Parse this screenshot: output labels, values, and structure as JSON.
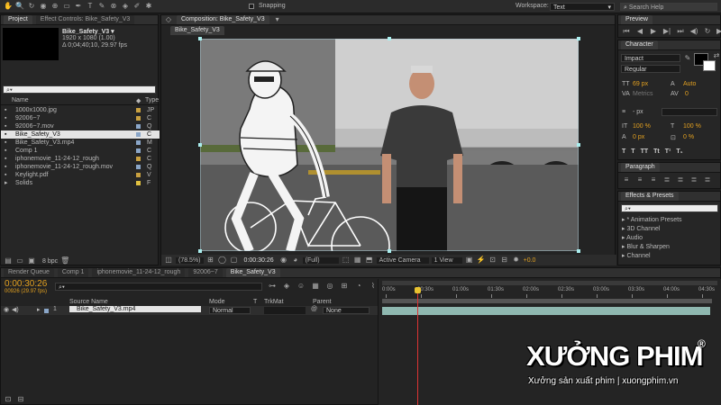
{
  "toolbar": {
    "snapping_label": "Snapping",
    "workspace_label": "Workspace:",
    "workspace_value": "Text",
    "search_placeholder": "Search Help",
    "tools": [
      "hand-tool",
      "zoom-tool",
      "rotate-tool",
      "camera-tool",
      "pan-tool",
      "rect-mask-tool",
      "pen-tool",
      "type-tool",
      "brush-tool",
      "clone-tool",
      "eraser-tool",
      "roto-tool",
      "puppet-tool"
    ]
  },
  "project": {
    "tab_project": "Project",
    "tab_effect_controls": "Effect Controls: Bike_Safety_V3",
    "comp_name": "Bike_Safety_V3 ▾",
    "comp_dims": "1920 x 1080 (1.00)",
    "comp_duration": "Δ 0;04;40;10, 29.97 fps",
    "col_name": "Name",
    "col_type": "Type",
    "bpc": "8 bpc",
    "items": [
      {
        "name": "1000x1000.jpg",
        "type": "JP",
        "color": "#c8a040",
        "selected": false
      },
      {
        "name": "92006~7",
        "type": "C",
        "color": "#c8a040",
        "selected": false
      },
      {
        "name": "92006~7.mov",
        "type": "Q",
        "color": "#8aa6c8",
        "selected": false
      },
      {
        "name": "Bike_Safety_V3",
        "type": "C",
        "color": "#8aa6c8",
        "selected": true
      },
      {
        "name": "Bike_Safety_V3.mp4",
        "type": "M",
        "color": "#8aa6c8",
        "selected": false
      },
      {
        "name": "Comp 1",
        "type": "C",
        "color": "#8aa6c8",
        "selected": false
      },
      {
        "name": "iphonemovie_11-24-12_rough",
        "type": "C",
        "color": "#c8a040",
        "selected": false
      },
      {
        "name": "iphonemovie_11-24-12_rough.mov",
        "type": "Q",
        "color": "#8aa6c8",
        "selected": false
      },
      {
        "name": "Keylight.pdf",
        "type": "V",
        "color": "#c8a040",
        "selected": false
      },
      {
        "name": "Solids",
        "type": "F",
        "color": "#e0c040",
        "selected": false
      }
    ]
  },
  "composition": {
    "tab": "Composition: Bike_Safety_V3",
    "sub_tab": "Bike_Safety_V3",
    "zoom": "(78.5%)",
    "timecode": "0:00:30:26",
    "resolution": "(Full)",
    "camera": "Active Camera",
    "view": "1 View",
    "exposure": "+0.0"
  },
  "preview": {
    "title": "Preview"
  },
  "character": {
    "title": "Character",
    "font": "Impact",
    "style": "Regular",
    "size": "69 px",
    "leading": "Auto",
    "kerning": "Metrics",
    "tracking": "0",
    "stroke_unit": "- px",
    "vscale": "100 %",
    "hscale": "100 %",
    "baseline": "0 px",
    "tsume": "0 %",
    "fill_color": "#000000",
    "stroke_color": "#ffffff"
  },
  "paragraph": {
    "title": "Paragraph"
  },
  "effects": {
    "title": "Effects & Presets",
    "items": [
      "* Animation Presets",
      "3D Channel",
      "Audio",
      "Blur & Sharpen",
      "Channel"
    ]
  },
  "timeline": {
    "tabs": [
      "Render Queue",
      "Comp 1",
      "iphonemovie_11-24-12_rough",
      "92006~7",
      "Bike_Safety_V3"
    ],
    "current_time": "0:00:30:26",
    "frame_info": "00926 (29.97 fps)",
    "col_source": "Source Name",
    "col_mode": "Mode",
    "col_t": "T",
    "col_trkmat": "TrkMat",
    "col_parent": "Parent",
    "layer_num": "1",
    "layer_name": "Bike_Safety_V3.mp4",
    "layer_mode": "Normal",
    "layer_parent": "None",
    "ruler": [
      "0:00s",
      "00:30s",
      "01:00s",
      "01:30s",
      "02:00s",
      "02:30s",
      "03:00s",
      "03:30s",
      "04:00s",
      "04:30s"
    ],
    "playhead_fraction": 0.107
  },
  "watermark": {
    "brand": "XƯỞNG PHIM",
    "registered": "®",
    "tagline": "Xưởng sản xuất phim | xuongphim.vn"
  }
}
